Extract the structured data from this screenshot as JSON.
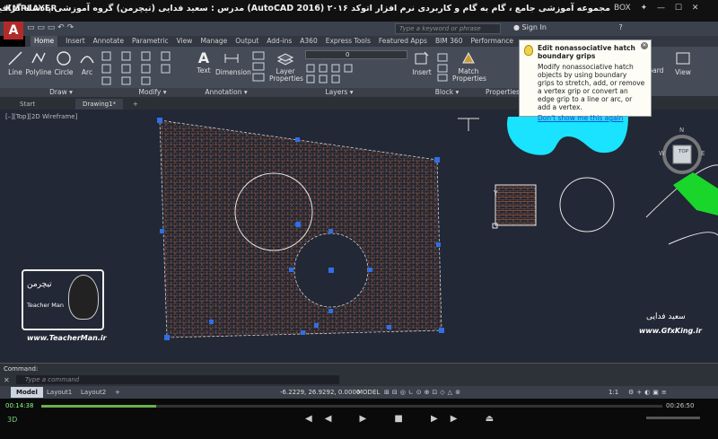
{
  "player": {
    "logo": "KMPLAYER",
    "title": "مجموعه آموزشی جامع ، گام به گام و کاربردی نرم افزار اتوکد ۲۰۱۶ (AutoCAD 2016)  مدرس : سعید فدایی (تیچرمن) گروه آموزشی پادشاه گرافیست ها",
    "btn_box": "BOX",
    "time_elapsed": "00:14:38",
    "time_total": "00:26:50",
    "progress": 0.185
  },
  "app": {
    "logo": "A",
    "search_placeholder": "Type a keyword or phrase",
    "sign_in": "Sign In"
  },
  "ribbon_tabs": [
    "Home",
    "Insert",
    "Annotate",
    "Parametric",
    "View",
    "Manage",
    "Output",
    "Add-ins",
    "A360",
    "Express Tools",
    "Featured Apps",
    "BIM 360",
    "Performance"
  ],
  "ribbon": {
    "line": "Line",
    "polyline": "Polyline",
    "circle": "Circle",
    "arc": "Arc",
    "text": "Text",
    "dimension": "Dimension",
    "layer_properties": "Layer Properties",
    "insert": "Insert",
    "match_properties": "Match Properties",
    "board": "oard",
    "view": "View",
    "layer_value": "0",
    "panel_draw": "Draw",
    "panel_modify": "Modify",
    "panel_annotation": "Annotation",
    "panel_layers": "Layers",
    "panel_block": "Block",
    "panel_properties": "Properties"
  },
  "doc_tabs": [
    "Start",
    "Drawing1*",
    "+"
  ],
  "viewport_label": "[–][Top][2D Wireframe]",
  "tooltip": {
    "title": "Edit nonassociative hatch boundary grips",
    "body": "Modify nonassociative hatch objects by using boundary grips to stretch, add, or remove a vertex grip or convert an edge grip to a line or arc, or add a vertex.",
    "link": "Don't show me this again"
  },
  "viewcube": {
    "top": "TOP",
    "n": "N",
    "w": "W",
    "e": "E"
  },
  "command": {
    "history": "Command:",
    "placeholder": "Type a command"
  },
  "layout_tabs": [
    "Model",
    "Layout1",
    "Layout2",
    "+"
  ],
  "status": {
    "coords": "-6.2229, 26.9292, 0.0000",
    "model": "MODEL",
    "scale": "1:1"
  },
  "watermark": {
    "brand": "تیچرمن",
    "brand_en": "Teacher Man",
    "site1": "www.TeacherMan.ir",
    "site2": "www.GfxKing.ir",
    "name_fa": "سعید فدایی"
  }
}
